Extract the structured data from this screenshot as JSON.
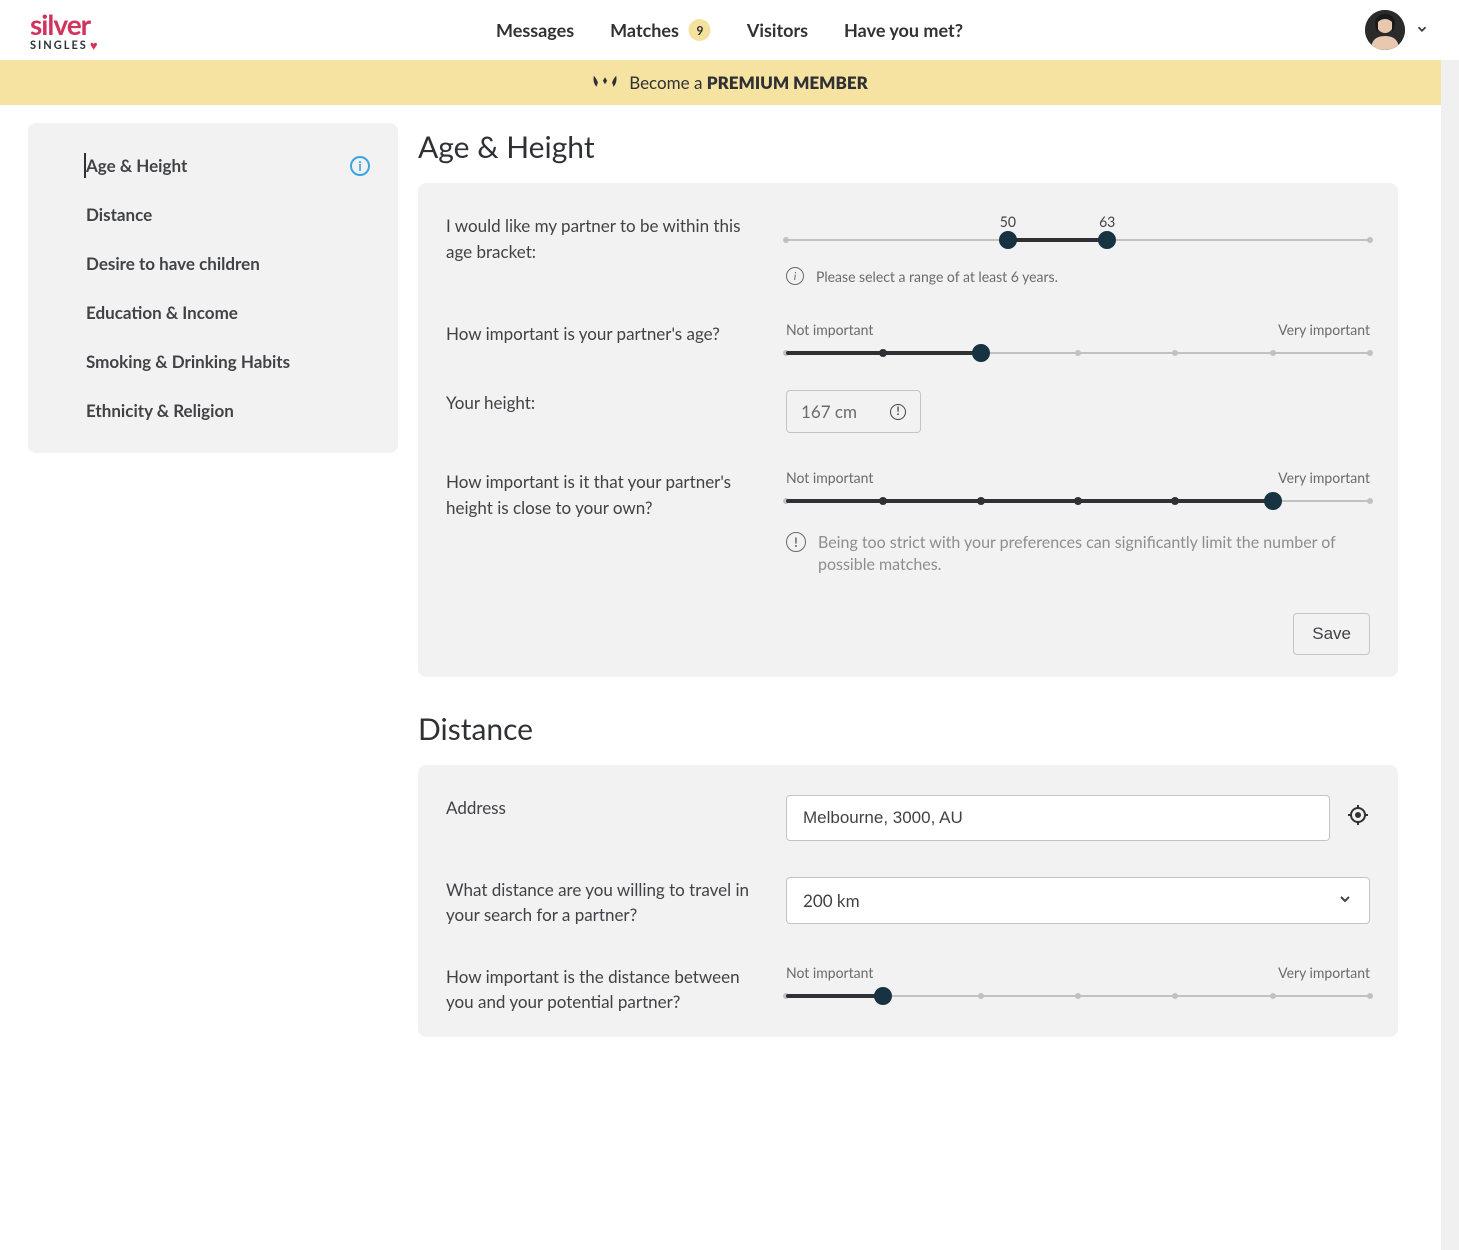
{
  "brand": {
    "top": "silver",
    "bottom": "SINGLES"
  },
  "nav": {
    "messages": "Messages",
    "matches": "Matches",
    "matches_badge": "9",
    "visitors": "Visitors",
    "have_you_met": "Have you met?"
  },
  "premium": {
    "prefix": "Become a ",
    "strong": "PREMIUM MEMBER"
  },
  "sidebar": {
    "items": [
      {
        "label": "Age & Height",
        "active": true,
        "info": true
      },
      {
        "label": "Distance"
      },
      {
        "label": "Desire to have children"
      },
      {
        "label": "Education & Income"
      },
      {
        "label": "Smoking & Drinking Habits"
      },
      {
        "label": "Ethnicity & Religion"
      }
    ]
  },
  "labels": {
    "not_important": "Not important",
    "very_important": "Very important"
  },
  "section_age": {
    "title": "Age & Height",
    "age_range_label": "I would like my partner to be within this age bracket:",
    "age_min": "50",
    "age_max": "63",
    "age_hint": "Please select a range of at least 6 years.",
    "age_importance_label": "How important is your partner's age?",
    "height_label": "Your height:",
    "height_value": "167 cm",
    "height_importance_label": "How important is it that your partner's height is close to your own?",
    "height_warn": "Being too strict with your preferences can significantly limit the number of possible matches.",
    "save": "Save",
    "age_range": {
      "min_pct": 38,
      "max_pct": 55
    },
    "age_importance_level": 2,
    "height_importance_level": 5
  },
  "section_distance": {
    "title": "Distance",
    "address_label": "Address",
    "address_value": "Melbourne, 3000, AU",
    "distance_label": "What distance are you willing to travel in your search for a partner?",
    "distance_value": "200 km",
    "distance_importance_label": "How important is the distance between you and your potential partner?",
    "distance_importance_level": 1
  }
}
